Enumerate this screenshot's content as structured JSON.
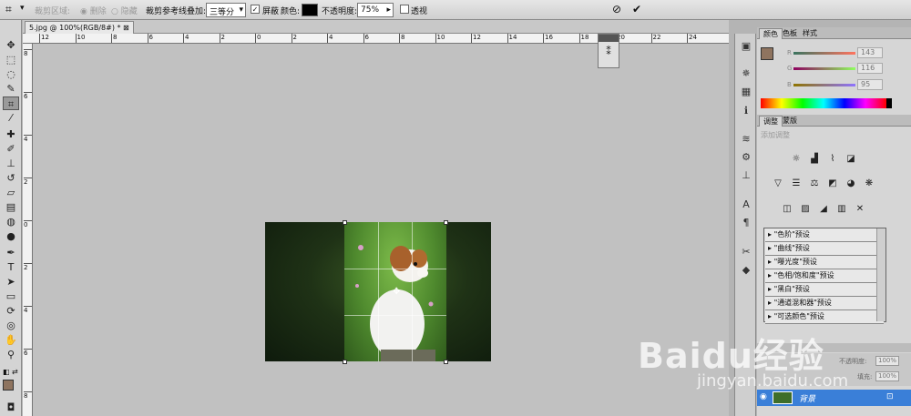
{
  "options": {
    "crop_area_label": "裁剪区域:",
    "delete_label": "删除",
    "hide_label": "隐藏",
    "overlay_label": "裁剪参考线叠加:",
    "overlay_value": "三等分",
    "shield_label": "屏蔽",
    "color_label": "颜色:",
    "opacity_label": "不透明度:",
    "opacity_value": "75%",
    "perspective_label": "透视",
    "shield_color": "#000000"
  },
  "document": {
    "tab_title": "5.jpg @ 100%(RGB/8#) *"
  },
  "ruler": {
    "h_ticks": [
      "12",
      "10",
      "8",
      "6",
      "4",
      "2",
      "0",
      "2",
      "4",
      "6",
      "8",
      "10",
      "12",
      "14",
      "16",
      "18",
      "20",
      "22",
      "24"
    ],
    "v_ticks": [
      "8",
      "6",
      "4",
      "2",
      "0",
      "2",
      "4",
      "6",
      "8"
    ]
  },
  "color_panel": {
    "tabs": [
      "颜色",
      "色板",
      "样式"
    ],
    "r_label": "R",
    "g_label": "G",
    "b_label": "B",
    "r": "143",
    "g": "116",
    "b": "95",
    "foreground": "#8f745f",
    "background": "#5aa0e0"
  },
  "adjust_panel": {
    "tabs": [
      "调整",
      "蒙版"
    ],
    "heading": "添加调整",
    "presets": [
      "\"色阶\"预设",
      "\"曲线\"预设",
      "\"曝光度\"预设",
      "\"色相/饱和度\"预设",
      "\"黑白\"预设",
      "\"通道混和器\"预设",
      "\"可选颜色\"预设"
    ]
  },
  "layers_panel": {
    "opacity_label": "不透明度:",
    "opacity_value": "100%",
    "fill_label": "填充:",
    "fill_value": "100%",
    "layer_name": "背景"
  },
  "watermark": {
    "brand": "Baidu经验",
    "url": "jingyan.baidu.com"
  }
}
